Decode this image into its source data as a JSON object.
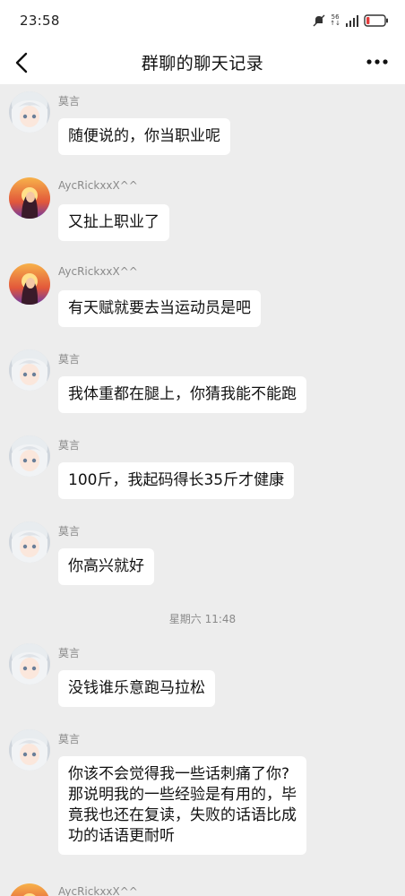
{
  "status": {
    "time": "23:58",
    "network": "56",
    "battery_level": 0.18
  },
  "nav": {
    "title": "群聊的聊天记录",
    "back_icon": "chevron-left-icon",
    "more_icon": "more-dots-icon"
  },
  "messages": [
    {
      "sender": "莫言",
      "avatar": "silver-hair-anime-avatar",
      "text": "随便说的，你当职业呢"
    },
    {
      "sender": "AycRickxxX^^",
      "avatar": "sunset-character-avatar",
      "text": "又扯上职业了"
    },
    {
      "sender": "AycRickxxX^^",
      "avatar": "sunset-character-avatar",
      "text": "有天赋就要去当运动员是吧"
    },
    {
      "sender": "莫言",
      "avatar": "silver-hair-anime-avatar",
      "text": "我体重都在腿上，你猜我能不能跑"
    },
    {
      "sender": "莫言",
      "avatar": "silver-hair-anime-avatar",
      "text": "100斤，我起码得长35斤才健康"
    },
    {
      "sender": "莫言",
      "avatar": "silver-hair-anime-avatar",
      "text": "你高兴就好"
    },
    {
      "sender": "莫言",
      "avatar": "silver-hair-anime-avatar",
      "text": "没钱谁乐意跑马拉松"
    },
    {
      "sender": "莫言",
      "avatar": "silver-hair-anime-avatar",
      "text": "你该不会觉得我一些话刺痛了你?\n那说明我的一些经验是有用的，毕\n竟我也还在复读，失败的话语比成\n功的话语更耐听"
    },
    {
      "sender": "AycRickxxX^^",
      "avatar": "sunset-character-avatar",
      "text": ""
    }
  ],
  "time_divider": "星期六 11:48"
}
